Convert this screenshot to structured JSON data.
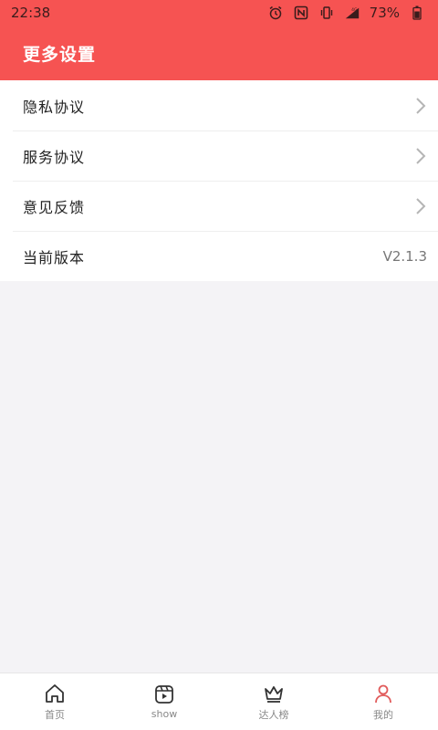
{
  "status_bar": {
    "time": "22:38",
    "battery": "73%",
    "network": "4G"
  },
  "header": {
    "title": "更多设置"
  },
  "settings": [
    {
      "label": "隐私协议",
      "value": "",
      "chevron": true
    },
    {
      "label": "服务协议",
      "value": "",
      "chevron": true
    },
    {
      "label": "意见反馈",
      "value": "",
      "chevron": true
    },
    {
      "label": "当前版本",
      "value": "V2.1.3",
      "chevron": false
    }
  ],
  "tabs": [
    {
      "label": "首页",
      "icon": "home-icon",
      "active": false
    },
    {
      "label": "show",
      "icon": "video-icon",
      "active": false
    },
    {
      "label": "达人榜",
      "icon": "crown-icon",
      "active": false
    },
    {
      "label": "我的",
      "icon": "user-icon",
      "active": true
    }
  ],
  "colors": {
    "accent": "#f65352",
    "active_icon": "#e15b5b",
    "background": "#f4f3f6"
  }
}
